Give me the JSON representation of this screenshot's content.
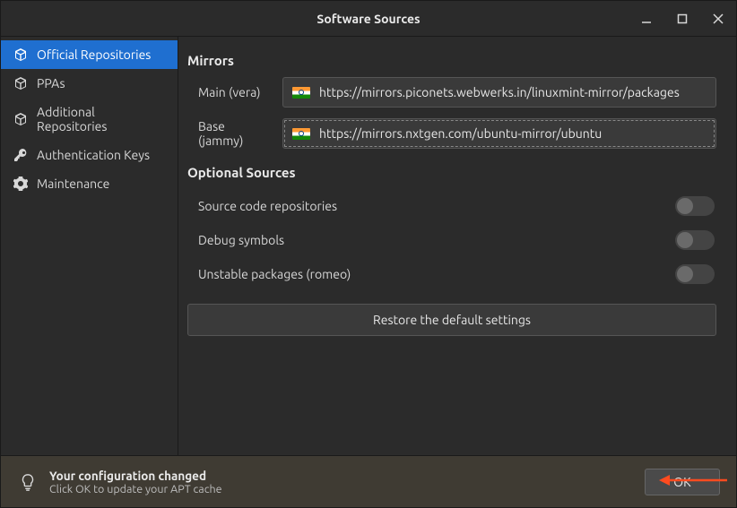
{
  "titlebar": {
    "title": "Software Sources"
  },
  "sidebar": {
    "items": [
      {
        "label": "Official Repositories"
      },
      {
        "label": "PPAs"
      },
      {
        "label": "Additional Repositories"
      },
      {
        "label": "Authentication Keys"
      },
      {
        "label": "Maintenance"
      }
    ]
  },
  "content": {
    "mirrors_heading": "Mirrors",
    "mirrors": [
      {
        "label": "Main (vera)",
        "url": "https://mirrors.piconets.webwerks.in/linuxmint-mirror/packages"
      },
      {
        "label": "Base (jammy)",
        "url": "https://mirrors.nxtgen.com/ubuntu-mirror/ubuntu"
      }
    ],
    "optional_heading": "Optional Sources",
    "options": [
      {
        "label": "Source code repositories",
        "on": false
      },
      {
        "label": "Debug symbols",
        "on": false
      },
      {
        "label": "Unstable packages (romeo)",
        "on": false
      }
    ],
    "restore_label": "Restore the default settings"
  },
  "bottombar": {
    "line1": "Your configuration changed",
    "line2": "Click OK to update your APT cache",
    "ok_label": "OK"
  }
}
